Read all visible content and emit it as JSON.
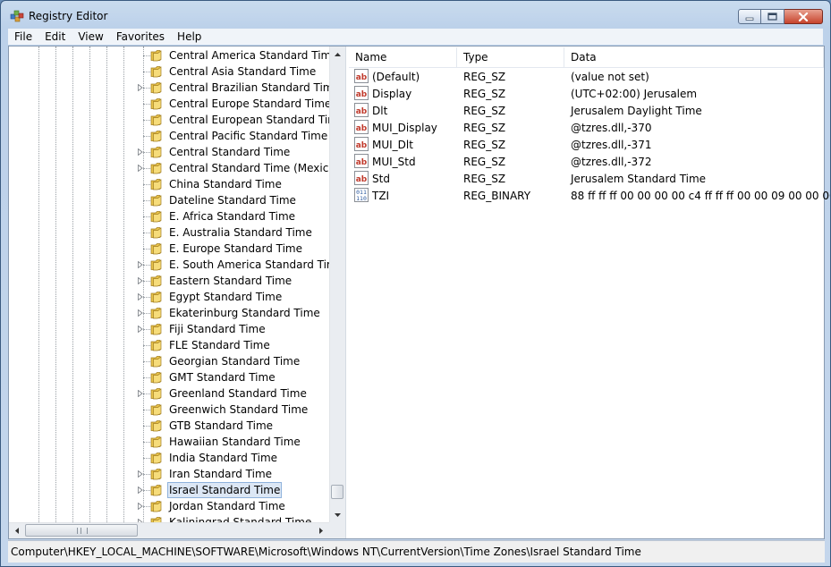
{
  "window": {
    "title": "Registry Editor"
  },
  "menu": [
    "File",
    "Edit",
    "View",
    "Favorites",
    "Help"
  ],
  "tree": {
    "nodes": [
      {
        "label": "Central America Standard Time",
        "expandable": false,
        "selected": false
      },
      {
        "label": "Central Asia Standard Time",
        "expandable": false,
        "selected": false
      },
      {
        "label": "Central Brazilian Standard Time",
        "expandable": true,
        "selected": false
      },
      {
        "label": "Central Europe Standard Time",
        "expandable": false,
        "selected": false
      },
      {
        "label": "Central European Standard Time",
        "expandable": false,
        "selected": false
      },
      {
        "label": "Central Pacific Standard Time",
        "expandable": false,
        "selected": false
      },
      {
        "label": "Central Standard Time",
        "expandable": true,
        "selected": false
      },
      {
        "label": "Central Standard Time (Mexico)",
        "expandable": true,
        "selected": false
      },
      {
        "label": "China Standard Time",
        "expandable": false,
        "selected": false
      },
      {
        "label": "Dateline Standard Time",
        "expandable": false,
        "selected": false
      },
      {
        "label": "E. Africa Standard Time",
        "expandable": false,
        "selected": false
      },
      {
        "label": "E. Australia Standard Time",
        "expandable": false,
        "selected": false
      },
      {
        "label": "E. Europe Standard Time",
        "expandable": false,
        "selected": false
      },
      {
        "label": "E. South America Standard Time",
        "expandable": true,
        "selected": false
      },
      {
        "label": "Eastern Standard Time",
        "expandable": true,
        "selected": false
      },
      {
        "label": "Egypt Standard Time",
        "expandable": true,
        "selected": false
      },
      {
        "label": "Ekaterinburg Standard Time",
        "expandable": true,
        "selected": false
      },
      {
        "label": "Fiji Standard Time",
        "expandable": true,
        "selected": false
      },
      {
        "label": "FLE Standard Time",
        "expandable": false,
        "selected": false
      },
      {
        "label": "Georgian Standard Time",
        "expandable": false,
        "selected": false
      },
      {
        "label": "GMT Standard Time",
        "expandable": false,
        "selected": false
      },
      {
        "label": "Greenland Standard Time",
        "expandable": true,
        "selected": false
      },
      {
        "label": "Greenwich Standard Time",
        "expandable": false,
        "selected": false
      },
      {
        "label": "GTB Standard Time",
        "expandable": false,
        "selected": false
      },
      {
        "label": "Hawaiian Standard Time",
        "expandable": false,
        "selected": false
      },
      {
        "label": "India Standard Time",
        "expandable": false,
        "selected": false
      },
      {
        "label": "Iran Standard Time",
        "expandable": true,
        "selected": false
      },
      {
        "label": "Israel Standard Time",
        "expandable": true,
        "selected": true
      },
      {
        "label": "Jordan Standard Time",
        "expandable": true,
        "selected": false
      },
      {
        "label": "Kaliningrad Standard Time",
        "expandable": true,
        "selected": false
      }
    ]
  },
  "list": {
    "columns": [
      "Name",
      "Type",
      "Data"
    ],
    "rows": [
      {
        "icon": "string-value-icon",
        "name": "(Default)",
        "type": "REG_SZ",
        "data": "(value not set)"
      },
      {
        "icon": "string-value-icon",
        "name": "Display",
        "type": "REG_SZ",
        "data": "(UTC+02:00) Jerusalem"
      },
      {
        "icon": "string-value-icon",
        "name": "Dlt",
        "type": "REG_SZ",
        "data": "Jerusalem Daylight Time"
      },
      {
        "icon": "string-value-icon",
        "name": "MUI_Display",
        "type": "REG_SZ",
        "data": "@tzres.dll,-370"
      },
      {
        "icon": "string-value-icon",
        "name": "MUI_Dlt",
        "type": "REG_SZ",
        "data": "@tzres.dll,-371"
      },
      {
        "icon": "string-value-icon",
        "name": "MUI_Std",
        "type": "REG_SZ",
        "data": "@tzres.dll,-372"
      },
      {
        "icon": "string-value-icon",
        "name": "Std",
        "type": "REG_SZ",
        "data": "Jerusalem Standard Time"
      },
      {
        "icon": "binary-value-icon",
        "name": "TZI",
        "type": "REG_BINARY",
        "data": "88 ff ff ff 00 00 00 00 c4 ff ff ff 00 00 09 00 00 00 02 0..."
      }
    ]
  },
  "status": {
    "path": "Computer\\HKEY_LOCAL_MACHINE\\SOFTWARE\\Microsoft\\Windows NT\\CurrentVersion\\Time Zones\\Israel Standard Time"
  },
  "colors": {
    "selection": "#dce7f5",
    "folder": "#e8c24a",
    "string_icon": "#c0392b",
    "binary_icon": "#2c5aa0"
  }
}
